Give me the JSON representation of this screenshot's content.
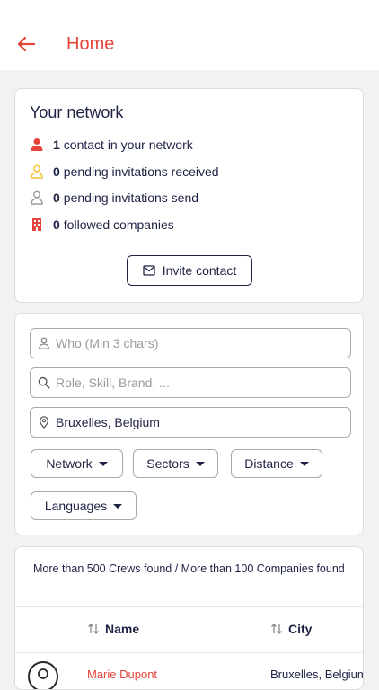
{
  "header": {
    "title": "Home"
  },
  "network": {
    "title": "Your network",
    "stats": [
      {
        "count": "1",
        "text": "contact in your network"
      },
      {
        "count": "0",
        "text": "pending invitations received"
      },
      {
        "count": "0",
        "text": "pending invitations send"
      },
      {
        "count": "0",
        "text": "followed companies"
      }
    ],
    "invite_label": "Invite contact"
  },
  "search": {
    "who_placeholder": "Who (Min 3 chars)",
    "role_placeholder": "Role, Skill, Brand, ...",
    "location_value": "Bruxelles, Belgium",
    "filters": [
      "Network",
      "Sectors",
      "Distance",
      "Languages"
    ]
  },
  "results": {
    "summary": "More than 500 Crews found / More than 100 Companies found",
    "columns": [
      "Name",
      "City"
    ],
    "rows": [
      {
        "name": "Marie Dupont",
        "city": "Bruxelles, Belgium"
      }
    ]
  },
  "colors": {
    "accent": "#e5443a",
    "navy": "#1e2345",
    "pending_received": "#f2c230",
    "pending_sent": "#9a9a9a"
  }
}
